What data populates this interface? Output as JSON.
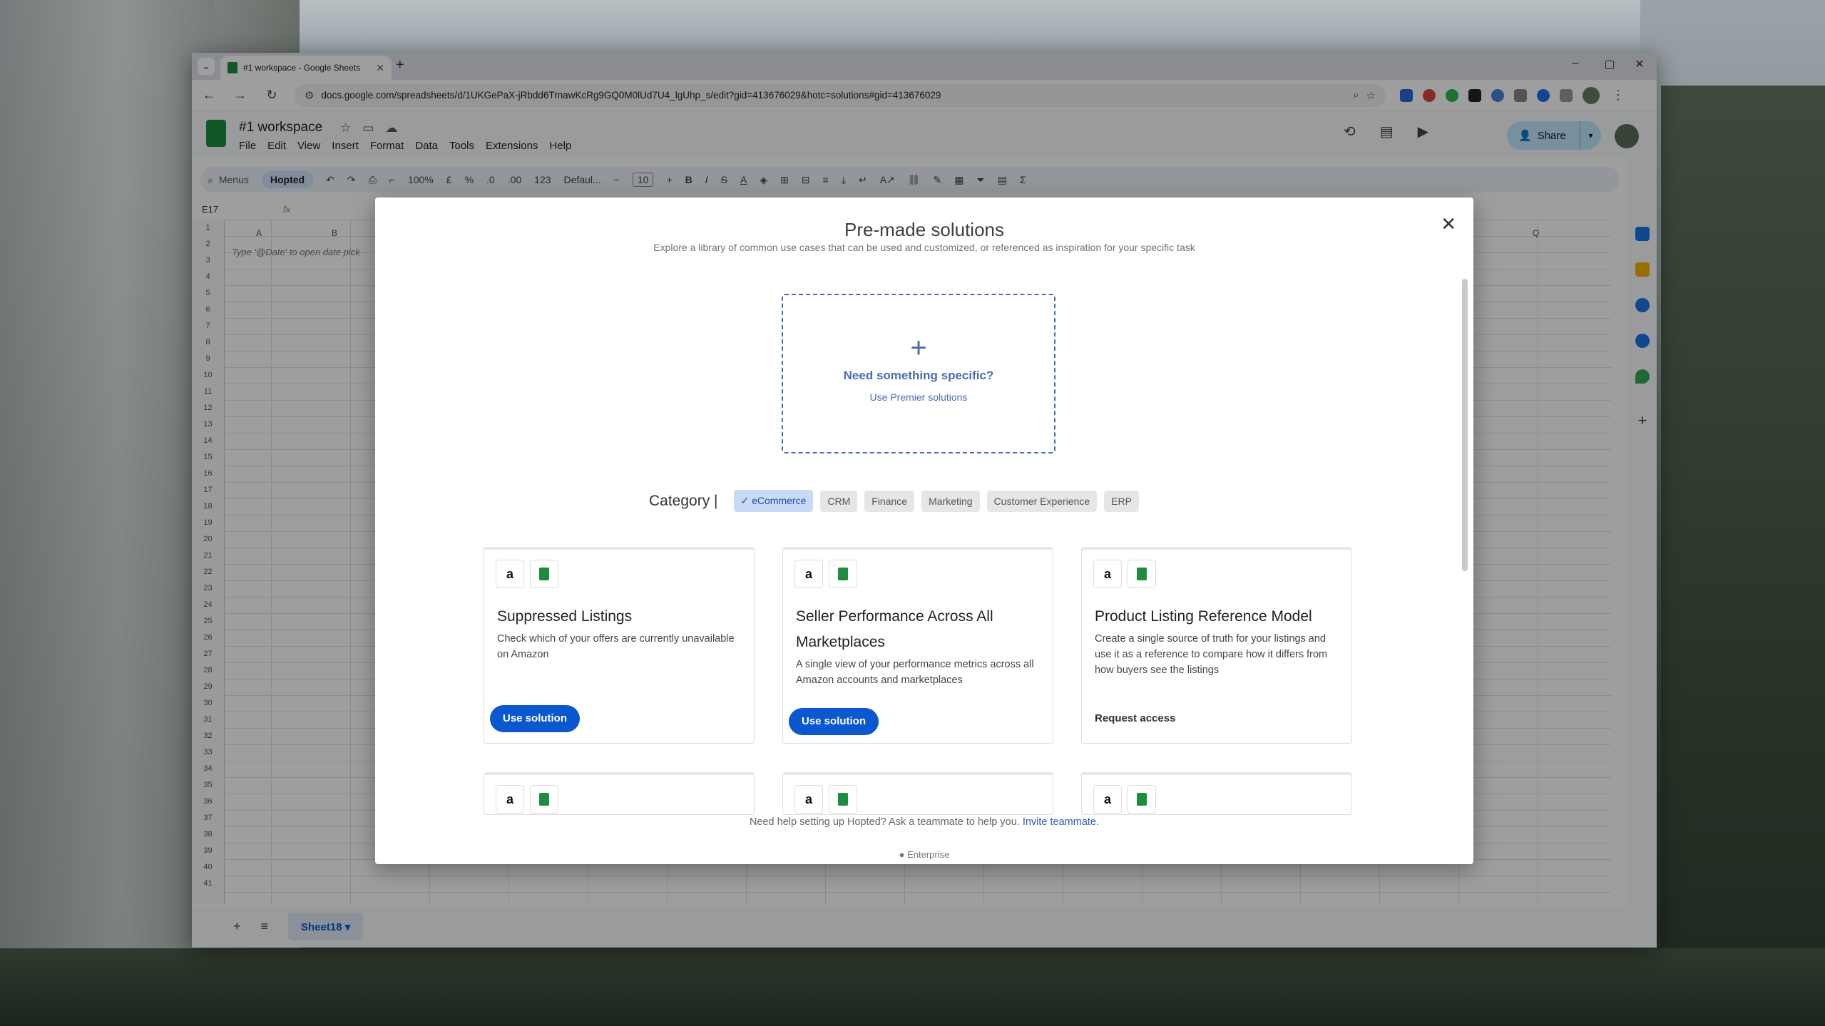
{
  "browser": {
    "tab_title": "#1 workspace - Google Sheets",
    "url": "docs.google.com/spreadsheets/d/1UKGePaX-jRbdd6TrnawKcRg9GQ0M0lUd7U4_lgUhp_s/edit?gid=413676029&hotc=solutions#gid=413676029"
  },
  "sheets": {
    "doc_title": "#1 workspace",
    "menu": [
      "File",
      "Edit",
      "View",
      "Insert",
      "Format",
      "Data",
      "Tools",
      "Extensions",
      "Help"
    ],
    "share_label": "Share",
    "toolbar": {
      "menus_label": "Menus",
      "hopted_label": "Hopted",
      "zoom": "100%",
      "currency": "£",
      "percent": "%",
      "num_format": "123",
      "font": "Defaul...",
      "font_size": "10"
    },
    "name_box": "E17",
    "cell_hint": "Type '@Date' to open date pick",
    "sheet_tab": "Sheet18",
    "columns": [
      "A",
      "B",
      "Q"
    ],
    "rows": [
      "1",
      "2",
      "3",
      "4",
      "5",
      "6",
      "7",
      "8",
      "9",
      "10",
      "11",
      "12",
      "13",
      "14",
      "15",
      "16",
      "17",
      "18",
      "19",
      "20",
      "21",
      "22",
      "23",
      "24",
      "25",
      "26",
      "27",
      "28",
      "29",
      "30",
      "31",
      "32",
      "33",
      "34",
      "35",
      "36",
      "37",
      "38",
      "39",
      "40",
      "41"
    ]
  },
  "modal": {
    "title": "Pre-made solutions",
    "subtitle": "Explore a library of common use cases that can be used and customized, or referenced as inspiration for your specific task",
    "custom": {
      "heading": "Need something specific?",
      "link": "Use Premier solutions"
    },
    "category_label": "Category |",
    "categories": [
      {
        "label": "eCommerce",
        "active": true
      },
      {
        "label": "CRM",
        "active": false
      },
      {
        "label": "Finance",
        "active": false
      },
      {
        "label": "Marketing",
        "active": false
      },
      {
        "label": "Customer Experience",
        "active": false
      },
      {
        "label": "ERP",
        "active": false
      }
    ],
    "cards": [
      {
        "title": "Suppressed Listings",
        "description": "Check which of your offers are currently unavailable on Amazon",
        "action": "Use solution"
      },
      {
        "title": "Seller Performance Across All Marketplaces",
        "description": "A single view of your performance metrics across all Amazon accounts and marketplaces",
        "action": "Use solution"
      },
      {
        "title": "Product Listing Reference Model",
        "description": "Create a single source of truth for your listings and use it as a reference to compare how it differs from how buyers see the listings",
        "action": "Request access"
      }
    ],
    "footer_text": "Need help setting up Hopted? Ask a teammate to help you.",
    "footer_link": "Invite teammate.",
    "enterprise": "Enterprise"
  },
  "icons": {
    "amazon_glyph": "a",
    "close": "✕",
    "plus": "+"
  }
}
